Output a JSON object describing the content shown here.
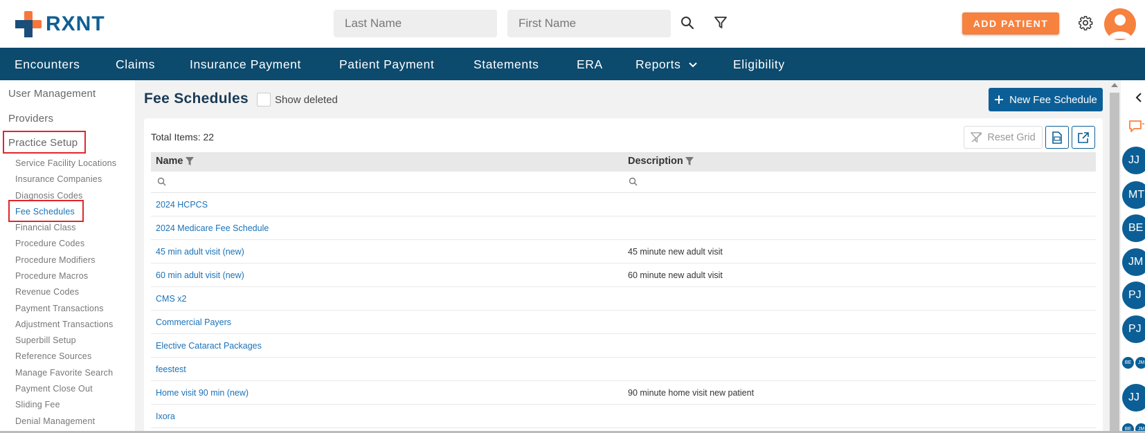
{
  "header": {
    "logo_text": "RXNT",
    "last_name_placeholder": "Last Name",
    "first_name_placeholder": "First Name",
    "add_patient_label": "ADD PATIENT",
    "search_icon": "search-icon",
    "filter_icon": "filter-icon",
    "settings_icon": "gear-icon",
    "brand_orange": "#f7813f",
    "brand_blue": "#0c4a6e"
  },
  "nav": {
    "items": [
      "Encounters",
      "Claims",
      "Insurance Payment",
      "Patient Payment",
      "Statements",
      "ERA",
      "Reports",
      "Eligibility"
    ]
  },
  "sidebar": {
    "top_items": [
      "User Management",
      "Providers",
      "Practice Setup"
    ],
    "sub_items": [
      "Service Facility Locations",
      "Insurance Companies",
      "Diagnosis Codes",
      "Fee Schedules",
      "Financial Class",
      "Procedure Codes",
      "Procedure Modifiers",
      "Procedure Macros",
      "Revenue Codes",
      "Payment Transactions",
      "Adjustment Transactions",
      "Superbill Setup",
      "Reference Sources",
      "Manage Favorite Search",
      "Payment Close Out",
      "Sliding Fee",
      "Denial Management"
    ],
    "active_sub_item": "Fee Schedules"
  },
  "main": {
    "title": "Fee Schedules",
    "show_deleted_label": "Show deleted",
    "new_button_label": "New Fee Schedule",
    "total_items": "Total Items: 22",
    "reset_grid_label": "Reset Grid",
    "columns": [
      "Name",
      "Description"
    ],
    "rows": [
      {
        "name": "2024 HCPCS",
        "description": ""
      },
      {
        "name": "2024 Medicare Fee Schedule",
        "description": ""
      },
      {
        "name": "45 min adult visit (new)",
        "description": "45 minute new adult visit"
      },
      {
        "name": "60 min adult visit (new)",
        "description": "60 minute new adult visit"
      },
      {
        "name": "CMS x2",
        "description": ""
      },
      {
        "name": "Commercial Payers",
        "description": ""
      },
      {
        "name": "Elective Cataract Packages",
        "description": ""
      },
      {
        "name": "feestest",
        "description": ""
      },
      {
        "name": "Home visit 90 min (new)",
        "description": "90 minute home visit new patient"
      },
      {
        "name": "Ixora",
        "description": ""
      }
    ]
  },
  "rail": {
    "chevron_icon": "chevron-left-icon",
    "chat_icon": "chat-icon",
    "avatars": [
      "JJ",
      "MT",
      "BE",
      "JM",
      "PJ",
      "PJ"
    ],
    "small_avatars": [
      "BE",
      "JM"
    ],
    "avatars_2": [
      "JJ"
    ]
  }
}
